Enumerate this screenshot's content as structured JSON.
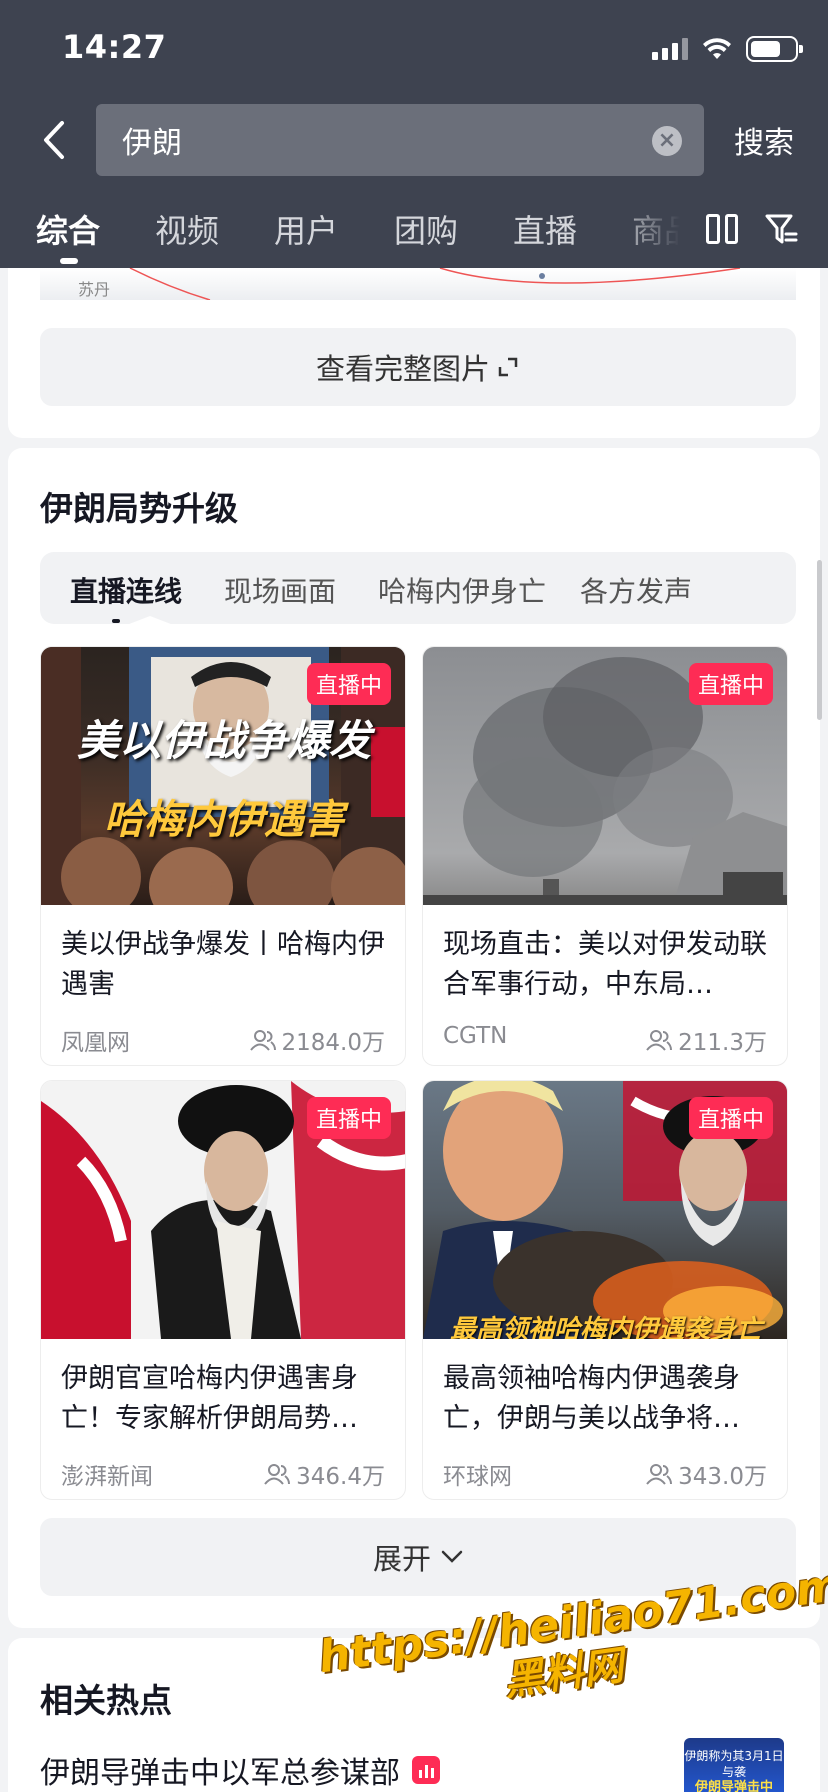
{
  "status": {
    "time": "14:27"
  },
  "search": {
    "query": "伊朗",
    "button": "搜索"
  },
  "tabs": [
    {
      "label": "综合",
      "active": true
    },
    {
      "label": "视频"
    },
    {
      "label": "用户"
    },
    {
      "label": "团购"
    },
    {
      "label": "直播"
    },
    {
      "label": "商品"
    }
  ],
  "map": {
    "place1": "苏丹"
  },
  "view_full_label": "查看完整图片",
  "section": {
    "title": "伊朗局势升级",
    "subtabs": [
      "直播连线",
      "现场画面",
      "哈梅内伊身亡",
      "各方发声"
    ],
    "live_label": "直播中",
    "videos": [
      {
        "title": "美以伊战争爆发丨哈梅内伊遇害",
        "source": "凤凰网",
        "viewers": "2184.0万",
        "overlay1": "美以伊战争爆发",
        "overlay2": "哈梅内伊遇害"
      },
      {
        "title": "现场直击：美以对伊发动联合军事行动，中东局…",
        "source": "CGTN",
        "viewers": "211.3万"
      },
      {
        "title": "伊朗官宣哈梅内伊遇害身亡！专家解析伊朗局势…",
        "source": "澎湃新闻",
        "viewers": "346.4万"
      },
      {
        "title": "最高领袖哈梅内伊遇袭身亡，伊朗与美以战争将…",
        "source": "环球网",
        "viewers": "343.0万",
        "overlay1": "最高领袖哈梅内伊遇袭身亡"
      }
    ],
    "expand_label": "展开"
  },
  "hot": {
    "title": "相关热点",
    "item": "伊朗导弹击中以军总参谋部",
    "thumb_line1": "伊朗称为其3月1日与袭",
    "thumb_line2": "伊朗导弹击中"
  },
  "watermark": {
    "line1": "https://heiliao71.com",
    "line2": "黑料网"
  },
  "colors": {
    "header_bg": "#3e4350",
    "live_red": "#fe2c55",
    "watermark": "#f5b400"
  }
}
